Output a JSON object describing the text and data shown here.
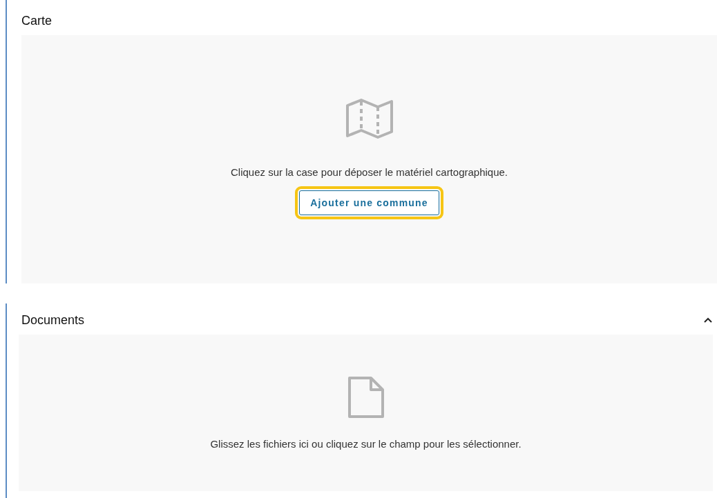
{
  "sections": [
    {
      "kind": "map",
      "title": "Carte",
      "hint": "Cliquez sur la case pour déposer le matériel cartographique.",
      "button": {
        "label": "Ajouter une commune",
        "focused": true
      }
    },
    {
      "kind": "documents",
      "title": "Documents",
      "expanded": true,
      "hint": "Glissez les fichiers ici ou cliquez sur le champ pour les sélectionner."
    }
  ]
}
